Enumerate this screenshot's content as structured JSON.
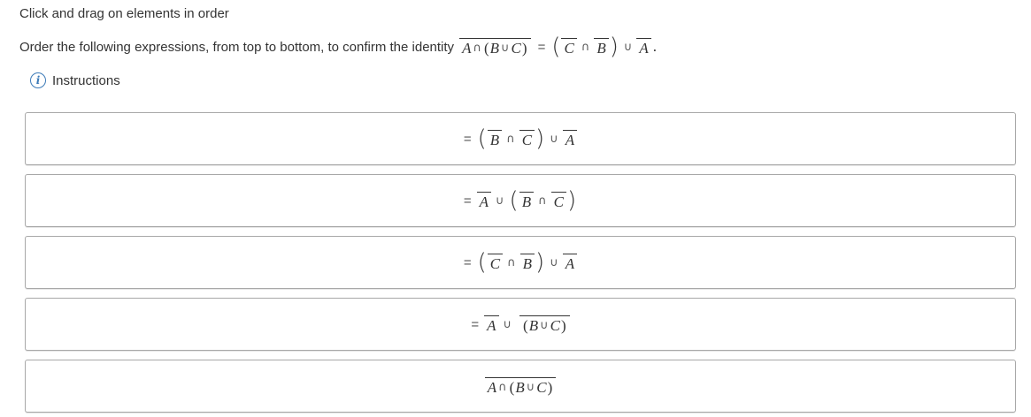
{
  "header": {
    "prompt": "Click and drag on elements in order",
    "question_text": "Order the following expressions, from top to bottom, to confirm the identity",
    "instructions_label": "Instructions"
  },
  "symbols": {
    "A": "A",
    "B": "B",
    "C": "C",
    "cap": "∩",
    "cup": "∪",
    "eq": "=",
    "lparen": "(",
    "rparen": ")",
    "period": "."
  },
  "cards": [
    {
      "expression": "= ((B̄ ∩ C̄) ∪ Ā)"
    },
    {
      "expression": "= Ā ∪ (B̄ ∩ C̄)"
    },
    {
      "expression": "= (C̄ ∩ B̄) ∪ Ā"
    },
    {
      "expression": "= Ā ∪ ‾(B ∪ C)"
    },
    {
      "expression": "‾(A ∩ (B ∪ C))"
    }
  ]
}
